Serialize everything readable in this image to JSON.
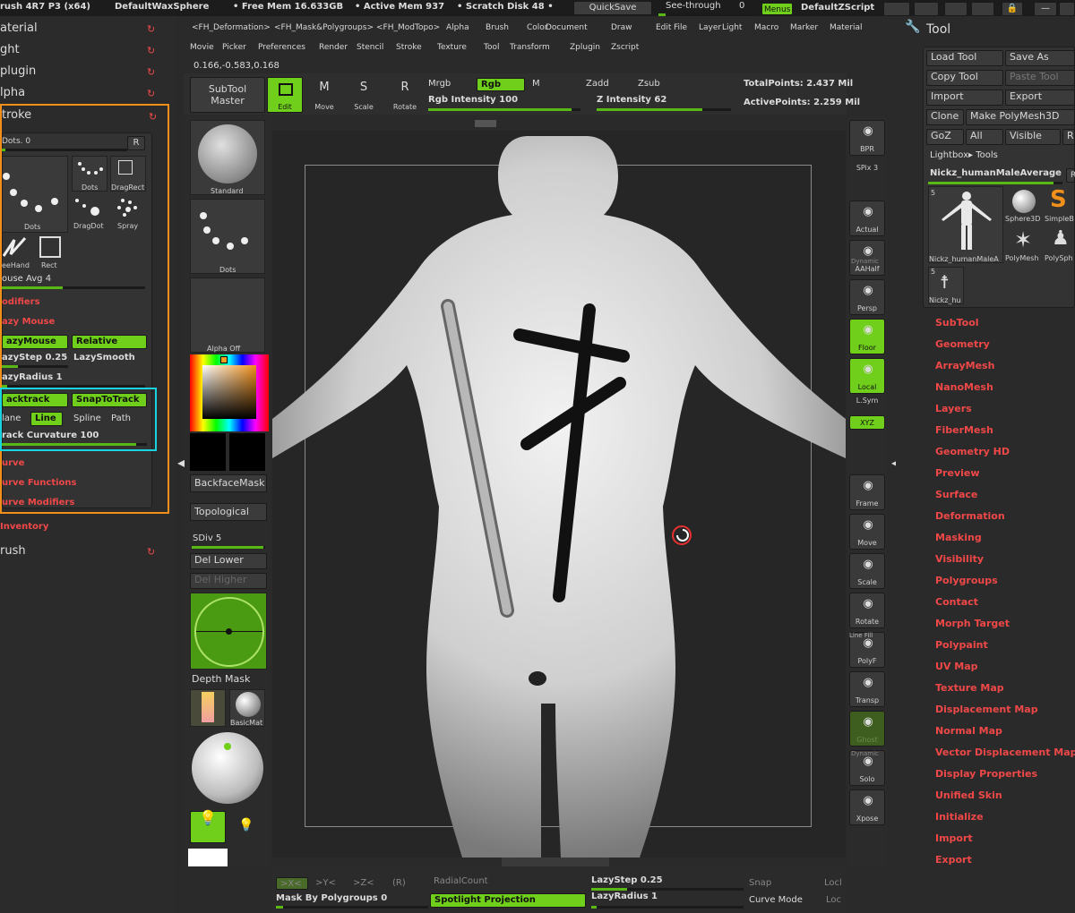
{
  "topbar": {
    "app": "rush 4R7 P3 (x64)",
    "doc": "DefaultWaxSphere",
    "freemem": "• Free Mem 16.633GB",
    "activemem": "• Active Mem 937",
    "scratch": "• Scratch Disk 48 •",
    "quicksave": "QuickSave",
    "seethrough": "See-through",
    "seethrough_val": "0",
    "menus": "Menus",
    "script": "DefaultZScript"
  },
  "menus1": [
    "<FH_Deformation>",
    "<FH_Mask&Polygroups>",
    "<FH_ModTopo>",
    "Alpha",
    "Brush",
    "Color",
    "Document",
    "Draw",
    "Edit",
    "File",
    "Layer",
    "Light",
    "Macro",
    "Marker",
    "Material"
  ],
  "menus2": [
    "Movie",
    "Picker",
    "Preferences",
    "Render",
    "Stencil",
    "Stroke",
    "Texture",
    "Tool",
    "Transform",
    "Zplugin",
    "Zscript"
  ],
  "coords": "0.166,-0.583,0.168",
  "left": {
    "rows": [
      "aterial",
      "ght",
      "plugin",
      "lpha"
    ],
    "stroke_title": "troke",
    "dots": "Dots. 0",
    "r": "R",
    "strokes": [
      "Dots",
      "DragRect",
      "DragDot",
      "Spray",
      "Dots",
      "eeHand",
      "Rect"
    ],
    "mouse_avg": "ouse Avg 4",
    "modifiers": "odifiers",
    "lazy_mouse": "azy Mouse",
    "lazymouse_btn": "azyMouse",
    "relative": "Relative",
    "lazystep": "azyStep 0.25",
    "lazysmooth": "LazySmooth",
    "lazyradius": "azyRadius 1",
    "backtrack": "acktrack",
    "snaptotrack": "SnapToTrack",
    "plane": "lane",
    "line": "Line",
    "spline": "Spline",
    "path": "Path",
    "track_curv": "rack Curvature 100",
    "curve": "urve",
    "curve_functions": "urve Functions",
    "curve_modifiers": "urve Modifiers",
    "inventory": "Inventory",
    "brush": "rush"
  },
  "shelf": {
    "subtool_master": "SubTool\nMaster",
    "edit": "Edit",
    "move": "Move",
    "scale": "Scale",
    "rotate": "Rotate",
    "mrgb": "Mrgb",
    "rgb": "Rgb",
    "m": "M",
    "zadd": "Zadd",
    "zsub": "Zsub",
    "rgb_int": "Rgb Intensity 100",
    "z_int": "Z Intensity 62",
    "totalpoints": "TotalPoints: 2.437 Mil",
    "activepoints": "ActivePoints: 2.259 Mil"
  },
  "tray": {
    "standard": "Standard",
    "dots": "Dots",
    "alpha": "Alpha Off",
    "backface": "BackfaceMask",
    "topological": "Topological",
    "sdiv": "SDiv 5",
    "dellower": "Del Lower",
    "delhigher": "Del Higher",
    "depthmask": "Depth Mask",
    "basicmat": "BasicMat"
  },
  "rshelf": [
    "BPR",
    "SPix 3",
    "Actual",
    "AAHalf",
    "Persp",
    "Floor",
    "Local",
    "L.Sym",
    "XYZ",
    "Frame",
    "Move",
    "Scale",
    "Rotate",
    "PolyF",
    "Transp",
    "Ghost",
    "Solo",
    "Xpose"
  ],
  "rshelf_extra": {
    "dynamic": "Dynamic",
    "linefill": "Line Fill",
    "dynamic2": "Dynamic"
  },
  "bottom": {
    "x": ">X<",
    "y": ">Y<",
    "z": ">Z<",
    "r": "(R)",
    "radial": "RadialCount",
    "mask_pg": "Mask By Polygroups 0",
    "spotlight": "Spotlight Projection",
    "lazystep": "LazyStep 0.25",
    "lazyradius": "LazyRadius 1",
    "snap": "Snap",
    "curvemode": "Curve Mode",
    "locl": "Locl",
    "loc": "Loc"
  },
  "tool": {
    "title": "Tool",
    "load": "Load Tool",
    "saveas": "Save As",
    "copy": "Copy Tool",
    "paste": "Paste Tool",
    "import": "Import",
    "export": "Export",
    "clone": "Clone",
    "makepm": "Make PolyMesh3D",
    "goz": "GoZ",
    "all": "All",
    "visible": "Visible",
    "r": "R",
    "lightbox": "Lightbox▸ Tools",
    "current": "Nickz_humanMaleAverage",
    "thumbs": [
      "Nickz_humanMaleA",
      "Sphere3D",
      "SimpleB",
      "PolyMesh",
      "PolySph",
      "Nickz_hu"
    ],
    "count5": "5",
    "count5b": "5",
    "sections": [
      "SubTool",
      "Geometry",
      "ArrayMesh",
      "NanoMesh",
      "Layers",
      "FiberMesh",
      "Geometry HD",
      "Preview",
      "Surface",
      "Deformation",
      "Masking",
      "Visibility",
      "Polygroups",
      "Contact",
      "Morph Target",
      "Polypaint",
      "UV Map",
      "Texture Map",
      "Displacement Map",
      "Normal Map",
      "Vector Displacement Map",
      "Display Properties",
      "Unified Skin",
      "Initialize",
      "Import",
      "Export"
    ]
  },
  "colors": {
    "accent": "#6fcf1a",
    "section": "#f04848",
    "orange": "#f0901a",
    "cyan": "#19d3e0"
  }
}
